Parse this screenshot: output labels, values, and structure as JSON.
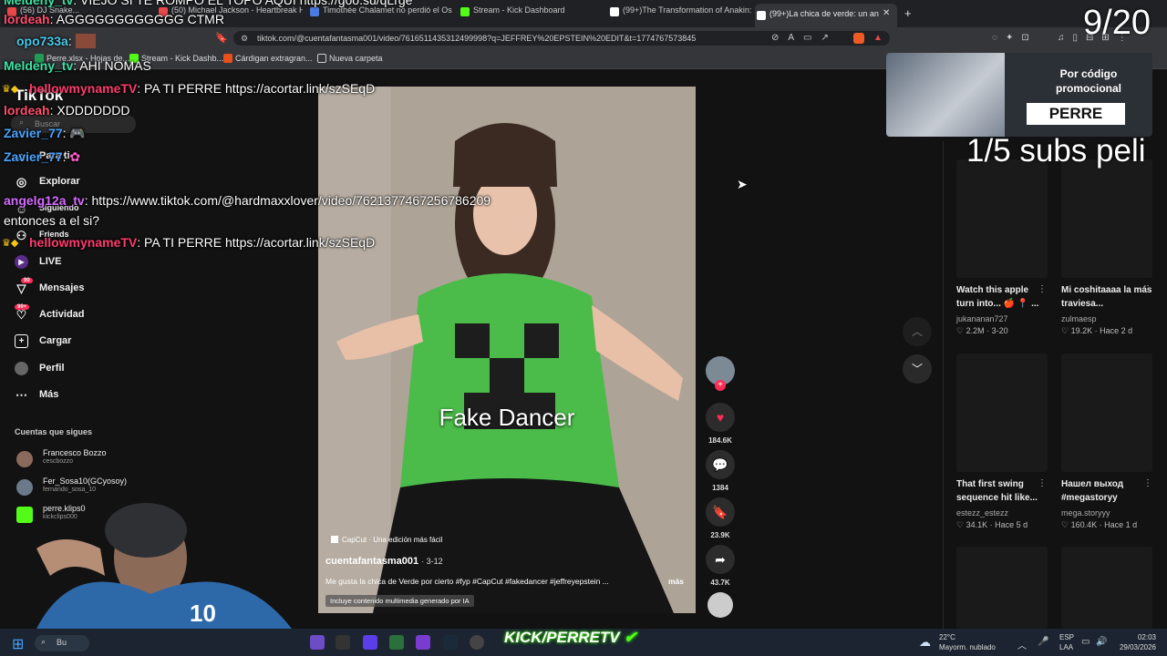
{
  "browser": {
    "tabs": [
      {
        "label": "(56) DJ Snake...",
        "color": "#e84848"
      },
      {
        "label": "(50) Michael Jackson - Heartbreak H",
        "color": "#e84848"
      },
      {
        "label": "Timothée Chalamet no perdió el Os",
        "color": "#4a7be0"
      },
      {
        "label": "Stream - Kick Dashboard",
        "color": "#53fc18"
      },
      {
        "label": "(99+)The Transformation of Anakin:",
        "color": "#ffffff"
      },
      {
        "label": "(99+)La chica de verde: un an",
        "color": "#ffffff"
      }
    ],
    "url": "tiktok.com/@cuentafantasma001/video/7616511435312499998?q=JEFFREY%20EPSTEIN%20EDIT&t=1774767573845",
    "bookmarks": [
      "Perre.xlsx - Hojas de...",
      "Stream - Kick Dashb...",
      "Cárdigan extragran...",
      "Nueva carpeta"
    ]
  },
  "chat": [
    {
      "user": "Meldeny_tv",
      "text": ": VIEJO SI TE ROMPO EL TOPO AQUI https://goo.su/qLrge",
      "color": "#3ee0a1"
    },
    {
      "user": "lordeah",
      "text": ": AGGGGGGGGGGGG CTMR",
      "color": "#ff4f6d"
    },
    {
      "user": "opo733a",
      "text": ":",
      "color": "#48c8e8"
    },
    {
      "user": "Meldeny_tv",
      "text": ": AHI NOMAS",
      "color": "#3ee0a1"
    },
    {
      "user": "hellowmynameTV",
      "text": ": PA TI PERRE https://acortar.link/szSEqD",
      "color": "#ff3c6e"
    },
    {
      "user": "lordeah",
      "text": ": XDDDDDDD",
      "color": "#ff4f6d"
    },
    {
      "user": "Zavier_77",
      "text": ":",
      "color": "#4aa3ff"
    },
    {
      "user": "Zavier_77",
      "text": ":",
      "color": "#4aa3ff"
    },
    {
      "user": "angelg12a_tv",
      "text": ": https://www.tiktok.com/@hardmaxxlover/video/7621377467256786209",
      "color": "#d46bff"
    },
    {
      "user": "",
      "text": "entonces a el si?",
      "color": "#ffffff"
    },
    {
      "user": "hellowmynameTV",
      "text": ": PA TI PERRE https://acortar.link/szSEqD",
      "color": "#ff3c6e"
    }
  ],
  "overlay": {
    "counter": "9/20",
    "promo_line1": "Por código",
    "promo_line2": "promocional",
    "promo_code": "PERRE",
    "subs": "1/5 subs peli",
    "kick_brand": "KICK/PERRETV"
  },
  "tiktok": {
    "logo": "TikTok",
    "search_placeholder": "Buscar",
    "nav": [
      {
        "label": "Para ti",
        "icon": "home-icon"
      },
      {
        "label": "Explorar",
        "icon": "compass-icon"
      },
      {
        "label": "Siguiendo",
        "icon": "following-icon"
      },
      {
        "label": "Friends",
        "icon": "friends-icon"
      },
      {
        "label": "LIVE",
        "icon": "live-icon"
      },
      {
        "label": "Mensajes",
        "icon": "message-icon",
        "badge": "90"
      },
      {
        "label": "Actividad",
        "icon": "activity-icon",
        "badge": "99+"
      },
      {
        "label": "Cargar",
        "icon": "upload-icon"
      },
      {
        "label": "Perfil",
        "icon": "profile-icon"
      },
      {
        "label": "Más",
        "icon": "more-icon"
      }
    ],
    "following_header": "Cuentas que sigues",
    "following": [
      {
        "name": "Francesco Bozzo",
        "handle": "cescbozzo",
        "color": "#8a6a5a"
      },
      {
        "name": "Fer_Sosa10(GCyosoy)",
        "handle": "fernando_sosa_10",
        "color": "#6a7a8a"
      },
      {
        "name": "perre.klips0",
        "handle": "kickclips000",
        "color": "#53fc18"
      }
    ],
    "video": {
      "caption_overlay": "Fake Dancer",
      "capcut_label": "CapCut · Una edición más fácil",
      "author": "cuentafantasma001",
      "date": "· 3-12",
      "description": "Me gusta la chica de Verde por cierto #fyp #CapCut #fakedancer #jeffreyepstein ...",
      "more": "más",
      "ai_label": "Incluye contenido multimedia generado por IA"
    },
    "actions": {
      "likes": "184.6K",
      "comments": "1384",
      "saves": "23.9K",
      "shares": "43.7K"
    },
    "grid": [
      {
        "title": "Watch this apple turn into... 🍎 📍 ...",
        "author": "jukananan727",
        "likes": "2.2M",
        "date": "3-20"
      },
      {
        "title": "Mi coshitaaaa la más traviesa...",
        "author": "zulmaesp",
        "likes": "19.2K",
        "date": "Hace 2 d"
      },
      {
        "title": "That first swing sequence hit like...",
        "author": "estezz_estezz",
        "likes": "34.1K",
        "date": "Hace 5 d"
      },
      {
        "title": "Нашел выход #megastoryy",
        "author": "mega.storyyy",
        "likes": "160.4K",
        "date": "Hace 1 d"
      }
    ]
  },
  "taskbar": {
    "search": "Bu",
    "weather_temp": "22°C",
    "weather_desc": "Mayorm. nublado",
    "lang1": "ESP",
    "lang2": "LAA",
    "time": "02:03",
    "date": "29/03/2026"
  }
}
